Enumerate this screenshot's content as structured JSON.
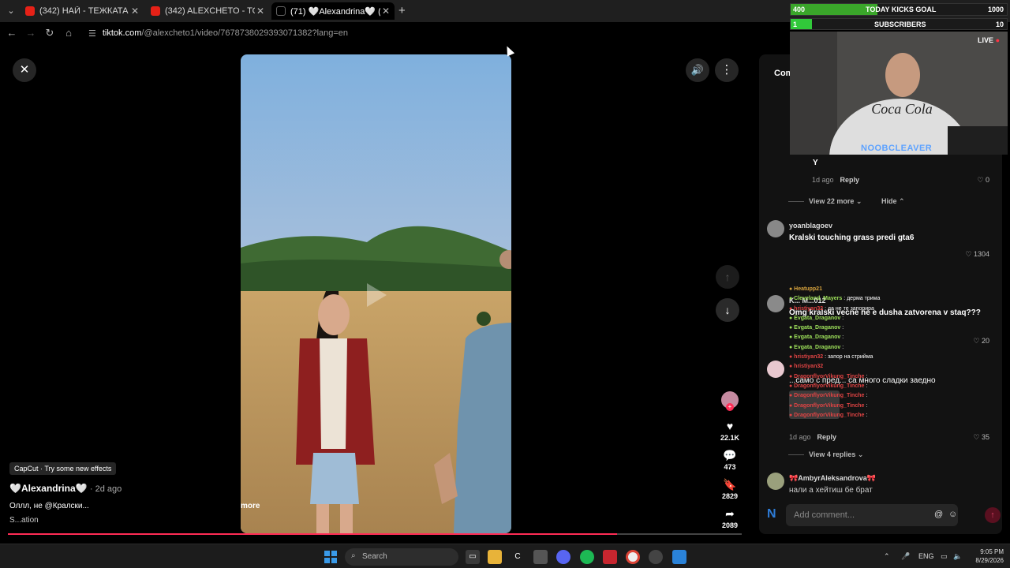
{
  "browser": {
    "tabs": [
      {
        "label": "(342) НАЙ - ТЕЖКАТА МИ",
        "icon": "youtube-icon"
      },
      {
        "label": "(342) ALEXCHETO - TOP FAKTA",
        "icon": "youtube-icon"
      },
      {
        "label": "(71) 🤍Alexandrina🤍 (@alexcheto1)",
        "icon": "tiktok-icon"
      }
    ],
    "url_host": "tiktok.com",
    "url_path": "/@alexcheto1/video/7678738029393071382?lang=en"
  },
  "video": {
    "capcut_label": "CapCut · Try some new effects",
    "author": "🤍Alexandrina🤍",
    "posted": "· 2d ago",
    "description": "Оллл, не @Кралски...",
    "more_label": "more",
    "music": "S...ation",
    "progress": 0.83,
    "actions": {
      "likes": "22.1K",
      "comments": "473",
      "saves": "2829",
      "shares": "2089"
    }
  },
  "comments": {
    "tab_label": "Com",
    "items": [
      {
        "text": "Y",
        "time": "1d ago",
        "reply": "Reply",
        "likes": "0"
      },
      {
        "user": "yoanblagoev",
        "text": "Kralski touching grass predi gta6",
        "likes": "1304"
      },
      {
        "user": "K... M...012",
        "text": "Omg kralski vecne ne e dusha zatvorena v staq???",
        "likes": "20"
      },
      {
        "user": "",
        "text": "...само с пред... са много сладки заедно",
        "time": "1d ago",
        "reply": "Reply",
        "likes": "35"
      },
      {
        "user": "🎀AmbyrAleksandrova🎀",
        "text": "нали а хейтиш бе брат"
      }
    ],
    "view_more": "View 22 more",
    "hide": "Hide",
    "view_replies": "View 4 replies",
    "add_placeholder": "Add comment..."
  },
  "overlay": {
    "goal_title": "TODAY KICKS GOAL",
    "goal_current": "400",
    "goal_target": "1000",
    "goal_progress": 0.4,
    "subs_title": "SUBSCRIBERS",
    "subs_current": "1",
    "subs_target": "10",
    "live_label": "LIVE",
    "streamer": "NOOBCLEAVER",
    "chat": [
      {
        "user": "Heatupp21",
        "msg": "",
        "color": "u3"
      },
      {
        "user": "Cleveland_Mayers",
        "msg": ": дерма трима",
        "color": "u1"
      },
      {
        "user": "hristiyan32",
        "msg": ": да не те запорира",
        "color": "u2"
      },
      {
        "user": "Evgata_Draganov",
        "msg": ":",
        "color": "u1"
      },
      {
        "user": "Evgata_Draganov",
        "msg": ":",
        "color": "u1"
      },
      {
        "user": "Evgata_Draganov",
        "msg": ":",
        "color": "u1"
      },
      {
        "user": "Evgata_Draganov",
        "msg": ":",
        "color": "u1"
      },
      {
        "user": "hristiyan32",
        "msg": ": запор на стрийма",
        "color": "u2"
      },
      {
        "user": "hristiyan32",
        "msg": "",
        "color": "u2"
      },
      {
        "user": "DragonflyorVikung_Tinche",
        "msg": ":",
        "color": "u2"
      },
      {
        "user": "DragonflyorVikung_Tinche",
        "msg": ":",
        "color": "u2"
      },
      {
        "user": "DragonflyorVikung_Tinche",
        "msg": ":",
        "color": "u2"
      },
      {
        "user": "DragonflyorVikung_Tinche",
        "msg": ":",
        "color": "u2"
      },
      {
        "user": "DragonflyorVikung_Tinche",
        "msg": ":",
        "color": "u2"
      }
    ]
  },
  "taskbar": {
    "search_placeholder": "Search",
    "lang": "ENG",
    "time": "9:05 PM",
    "date": "8/29/2026"
  }
}
